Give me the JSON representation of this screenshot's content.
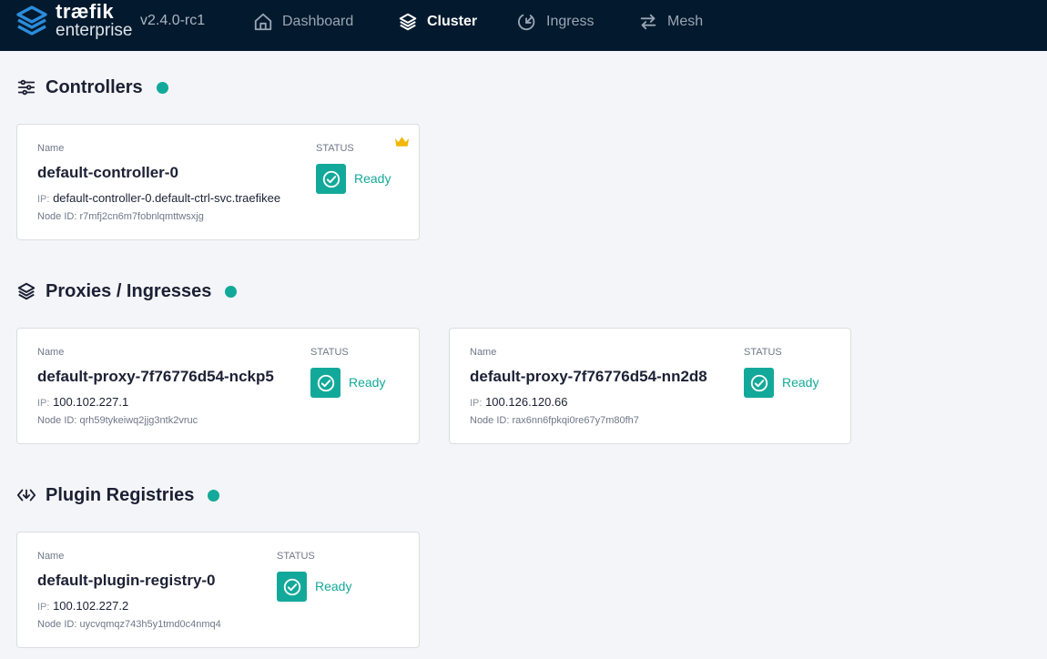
{
  "brand": {
    "line1": "træfik",
    "line2": "enterprise",
    "version": "v2.4.0-rc1"
  },
  "nav": {
    "dashboard": "Dashboard",
    "cluster": "Cluster",
    "ingress": "Ingress",
    "mesh": "Mesh",
    "active": "Cluster"
  },
  "colors": {
    "accent": "#13a99a",
    "topbar": "#03192d",
    "crown": "#f2b705"
  },
  "labels": {
    "name": "Name",
    "status": "STATUS",
    "ip": "IP:",
    "node_id": "Node ID:"
  },
  "sections": {
    "controllers": {
      "title": "Controllers",
      "icon": "sliders-icon",
      "cards": [
        {
          "name": "default-controller-0",
          "ip": "default-controller-0.default-ctrl-svc.traefikee",
          "node_id": "r7mfj2cn6m7fobnlqmttwsxjg",
          "status": "Ready",
          "leader": true
        }
      ]
    },
    "proxies": {
      "title": "Proxies / Ingresses",
      "icon": "layers-icon",
      "cards": [
        {
          "name": "default-proxy-7f76776d54-nckp5",
          "ip": "100.102.227.1",
          "node_id": "qrh59tykeiwq2jjg3ntk2vruc",
          "status": "Ready"
        },
        {
          "name": "default-proxy-7f76776d54-nn2d8",
          "ip": "100.126.120.66",
          "node_id": "rax6nn6fpkqi0re67y7m80fh7",
          "status": "Ready"
        }
      ]
    },
    "plugins": {
      "title": "Plugin Registries",
      "icon": "plugin-registry-icon",
      "cards": [
        {
          "name": "default-plugin-registry-0",
          "ip": "100.102.227.2",
          "node_id": "uycvqmqz743h5y1tmd0c4nmq4",
          "status": "Ready"
        }
      ]
    }
  }
}
